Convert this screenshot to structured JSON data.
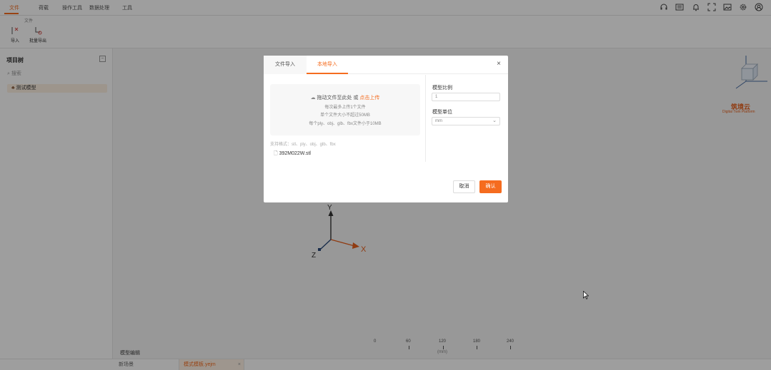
{
  "menu": {
    "items": [
      "文件",
      "荷载",
      "操作工具",
      "数据处理",
      "工具"
    ],
    "active_index": 0
  },
  "ribbon": {
    "group_title": "文件",
    "buttons": [
      {
        "label": "导入",
        "icon": "import-icon"
      },
      {
        "label": "批量导出",
        "icon": "export-icon"
      }
    ]
  },
  "toolbar_right_icons": [
    "headset-icon",
    "list-icon",
    "bell-icon",
    "fullscreen-icon",
    "image-icon",
    "gear-icon",
    "user-icon"
  ],
  "left_panel": {
    "title": "项目树",
    "search_placeholder": "搜索",
    "tree_items": [
      {
        "label": "测试模型",
        "icon": "model-icon"
      }
    ]
  },
  "viewport": {
    "logo_text": "筑境云",
    "logo_sub": "Digital Twin Platform",
    "axis_labels": {
      "x": "X",
      "y": "Y",
      "z": "Z"
    },
    "ruler_labels": [
      "0",
      "60",
      "120",
      "180",
      "240"
    ],
    "ruler_unit": "(mm)",
    "bottom_title": "模型编辑"
  },
  "bottom_tabs": [
    {
      "label": "新场景",
      "active": false
    },
    {
      "label": "模式模板.yejm",
      "active": true
    }
  ],
  "dialog": {
    "tabs": [
      {
        "label": "文件导入",
        "active": false
      },
      {
        "label": "本地导入",
        "active": true
      }
    ],
    "dropzone": {
      "prompt": "拖动文件至此处 或",
      "prompt_link": "点击上传",
      "line2": "每次最多上传1个文件",
      "line3": "单个文件大小不超过50MB",
      "line4": "每个ply、obj、glb、fbx文件小于10MB"
    },
    "support_formats": "支持格式：stl、ply、obj、glb、fbx",
    "file_name": "392M022W.stl",
    "scale_label": "模型比例",
    "scale_value": "1",
    "unit_label": "模型单位",
    "unit_value": "mm",
    "cancel_label": "取消",
    "confirm_label": "确认"
  },
  "colors": {
    "accent": "#f56c1f",
    "axis_x": "#e8601c",
    "axis_y": "#333333",
    "axis_z": "#2b4a7a"
  }
}
